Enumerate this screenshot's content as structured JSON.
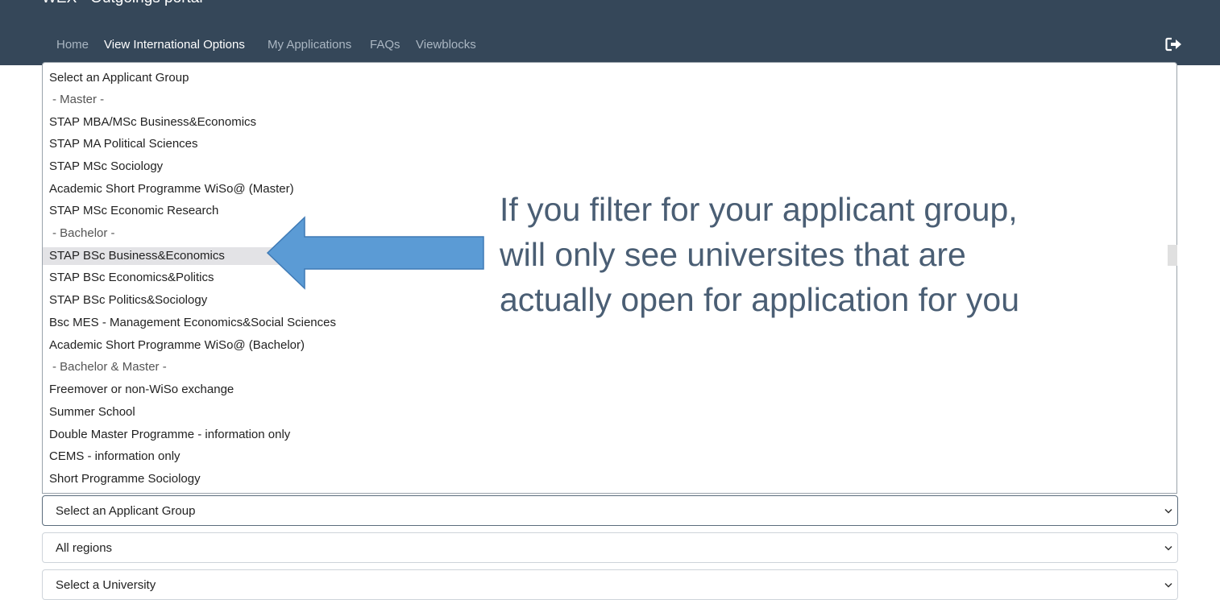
{
  "header": {
    "title": "WEX - Outgoings portal",
    "nav": [
      {
        "label": "Home",
        "active": false
      },
      {
        "label": "View International Options",
        "active": true
      },
      {
        "label": "My Applications",
        "active": false
      },
      {
        "label": "FAQs",
        "active": false
      },
      {
        "label": "Viewblocks",
        "active": false
      }
    ],
    "logout_icon": "sign-out-icon",
    "bg_color": "#354759"
  },
  "dropdown": {
    "options": [
      {
        "label": "Select an Applicant Group",
        "type": "option"
      },
      {
        "label": " - Master -",
        "type": "group"
      },
      {
        "label": "STAP MBA/MSc Business&Economics",
        "type": "option"
      },
      {
        "label": "STAP MA Political Sciences",
        "type": "option"
      },
      {
        "label": "STAP MSc Sociology",
        "type": "option"
      },
      {
        "label": "Academic Short Programme WiSo@ (Master)",
        "type": "option"
      },
      {
        "label": "STAP MSc Economic Research",
        "type": "option"
      },
      {
        "label": " - Bachelor -",
        "type": "group"
      },
      {
        "label": "STAP BSc Business&Economics",
        "type": "option",
        "hovered": true
      },
      {
        "label": "STAP BSc Economics&Politics",
        "type": "option"
      },
      {
        "label": "STAP BSc Politics&Sociology",
        "type": "option"
      },
      {
        "label": "Bsc MES - Management Economics&Social Sciences",
        "type": "option"
      },
      {
        "label": "Academic Short Programme WiSo@ (Bachelor)",
        "type": "option"
      },
      {
        "label": " - Bachelor & Master -",
        "type": "group"
      },
      {
        "label": "Freemover or non-WiSo exchange",
        "type": "option"
      },
      {
        "label": "Summer School",
        "type": "option"
      },
      {
        "label": "Double Master Programme - information only",
        "type": "option"
      },
      {
        "label": "CEMS - information only",
        "type": "option"
      },
      {
        "label": "Short Programme Sociology",
        "type": "option"
      }
    ]
  },
  "filters": {
    "applicant_group": "Select an Applicant Group",
    "region": "All regions",
    "university": "Select a University"
  },
  "annotation": {
    "lines": [
      "If you filter for your applicant group,",
      "will only see universites that are",
      "actually open for application for you"
    ],
    "arrow_color": "#5b9bd5",
    "text_color": "#4a5e74"
  }
}
